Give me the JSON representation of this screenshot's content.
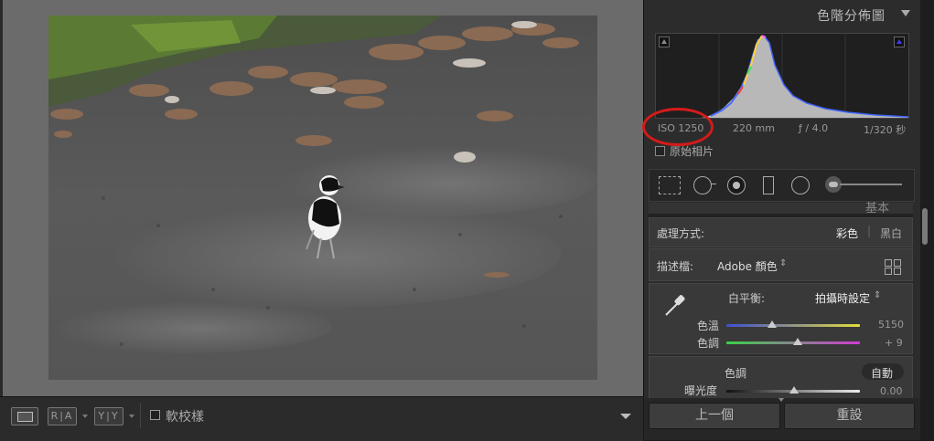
{
  "toolbar": {
    "loupe_label": "",
    "ra_label": "R|A",
    "yy_label": "Y|Y",
    "softproof_label": "軟校樣"
  },
  "histogram": {
    "title": "色階分佈圖",
    "iso": "ISO 1250",
    "focal": "220 mm",
    "aperture": "ƒ / 4.0",
    "shutter": "1/320 秒",
    "original_photo_label": "原始相片"
  },
  "basic": {
    "title": "基本",
    "treatment_label": "處理方式:",
    "treatment_color": "彩色",
    "treatment_bw": "黑白",
    "profile_label": "描述檔:",
    "profile_value": "Adobe 顏色",
    "wb_label": "白平衡:",
    "wb_value": "拍攝時設定",
    "temp_label": "色溫",
    "temp_value": "5150",
    "tint_label": "色調",
    "tint_value": "+ 9",
    "tone_label": "色調",
    "tone_auto": "自動",
    "exposure_label": "曝光度",
    "exposure_value": "0.00"
  },
  "buttons": {
    "previous": "上一個",
    "reset": "重設"
  },
  "colors": {
    "annotation_circle": "#d61a1a",
    "panel_bg": "#2c2c2c",
    "viewer_bg": "#6b6b6b"
  }
}
